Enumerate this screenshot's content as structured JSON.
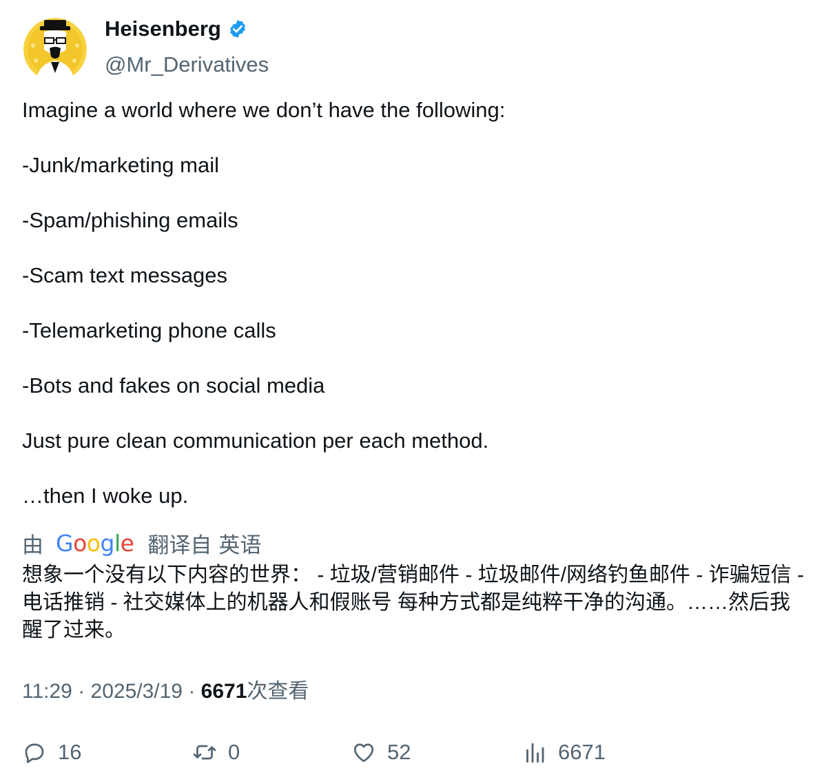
{
  "author": {
    "display_name": "Heisenberg",
    "handle": "@Mr_Derivatives",
    "verified": true,
    "avatar_icon": "heisenberg-avatar",
    "verified_color": "#1d9bf0"
  },
  "tweet": {
    "intro": "Imagine a world where we don’t have the following:",
    "items": [
      "-Junk/marketing mail",
      "-Spam/phishing emails",
      "-Scam text messages",
      "-Telemarketing phone calls",
      "-Bots and fakes on social media"
    ],
    "closing": "Just pure clean communication per each method.",
    "ending": "…then I woke up."
  },
  "translation": {
    "by_label": "由",
    "provider": "Google",
    "from_label": "翻译自",
    "source_language": "英语",
    "text": "想象一个没有以下内容的世界： - 垃圾/营销邮件 - 垃圾邮件/网络钓鱼邮件 - 诈骗短信 - 电话推销 - 社交媒体上的机器人和假账号 每种方式都是纯粹干净的沟通。……然后我醒了过来。"
  },
  "meta": {
    "time": "11:29",
    "separator": " · ",
    "date": "2025/3/19",
    "views_count": "6671",
    "views_label": "次查看"
  },
  "actions": {
    "replies": "16",
    "retweets": "0",
    "likes": "52",
    "views": "6671"
  },
  "colors": {
    "text_primary": "#0f1419",
    "text_secondary": "#536471",
    "accent": "#1d9bf0"
  }
}
